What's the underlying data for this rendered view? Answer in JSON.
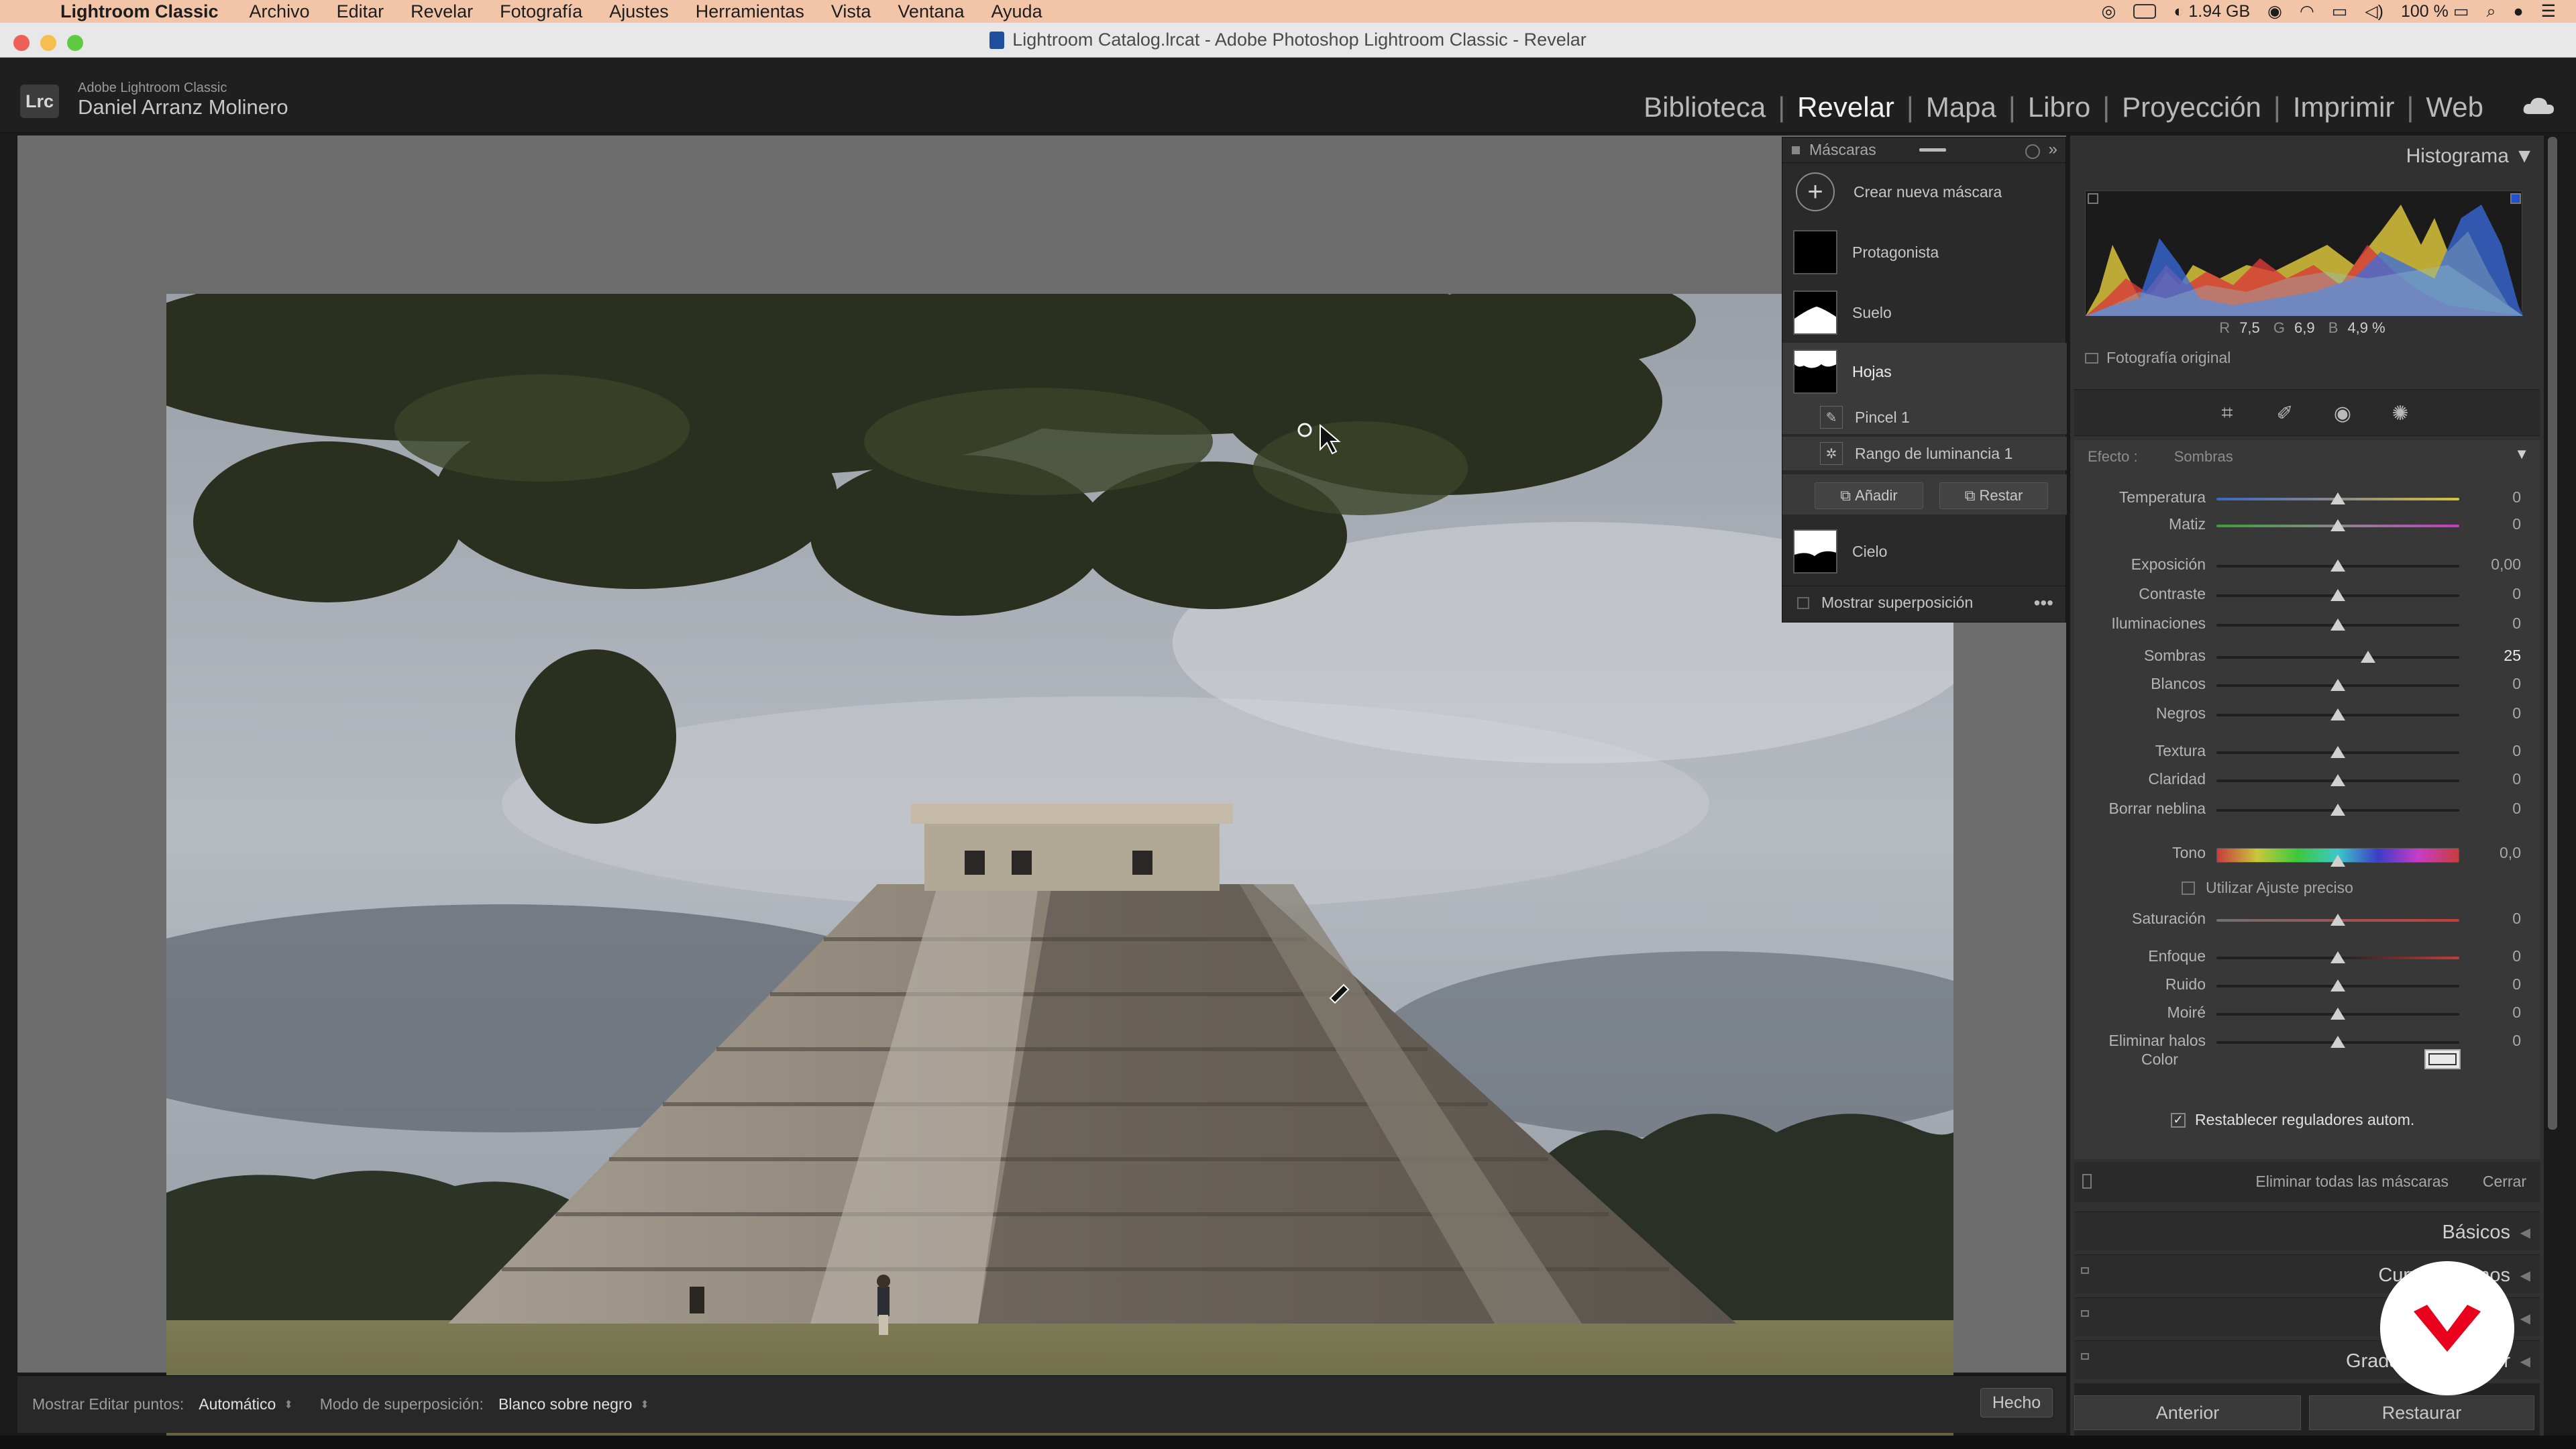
{
  "menubar": {
    "app_name": "Lightroom Classic",
    "items": [
      "Archivo",
      "Editar",
      "Revelar",
      "Fotografía",
      "Ajustes",
      "Herramientas",
      "Vista",
      "Ventana",
      "Ayuda"
    ],
    "memory": "1.94 GB",
    "battery": "100 %"
  },
  "window": {
    "title": "Lightroom Catalog.lrcat - Adobe Photoshop Lightroom Classic - Revelar"
  },
  "identity": {
    "badge": "Lrc",
    "product": "Adobe Lightroom Classic",
    "user": "Daniel Arranz Molinero"
  },
  "modules": [
    {
      "label": "Biblioteca",
      "active": false
    },
    {
      "label": "Revelar",
      "active": true
    },
    {
      "label": "Mapa",
      "active": false
    },
    {
      "label": "Libro",
      "active": false
    },
    {
      "label": "Proyección",
      "active": false
    },
    {
      "label": "Imprimir",
      "active": false
    },
    {
      "label": "Web",
      "active": false
    }
  ],
  "toolbar": {
    "show_pins_label": "Mostrar Editar puntos:",
    "show_pins_value": "Automático",
    "overlay_mode_label": "Modo de superposición:",
    "overlay_mode_value": "Blanco sobre negro",
    "done_label": "Hecho"
  },
  "masks_panel": {
    "title": "Máscaras",
    "create_label": "Crear nueva máscara",
    "masks": [
      {
        "name": "Protagonista",
        "selected": false
      },
      {
        "name": "Suelo",
        "selected": false
      },
      {
        "name": "Hojas",
        "selected": true
      },
      {
        "name": "Cielo",
        "selected": false
      }
    ],
    "components": [
      {
        "name": "Pincel 1"
      },
      {
        "name": "Rango de luminancia 1"
      }
    ],
    "add_label": "Añadir",
    "subtract_label": "Restar",
    "show_overlay_label": "Mostrar superposición"
  },
  "histogram": {
    "title": "Histograma",
    "r_label": "R",
    "r_value": "7,5",
    "g_label": "G",
    "g_value": "6,9",
    "b_label": "B",
    "b_value": "4,9 %",
    "original_label": "Fotografía original"
  },
  "adjustments": {
    "effect_label": "Efecto :",
    "effect_value": "Sombras",
    "sliders": [
      {
        "label": "Temperatura",
        "value": "0",
        "pos": 0.5,
        "gradient": "temp"
      },
      {
        "label": "Matiz",
        "value": "0",
        "pos": 0.5,
        "gradient": "tint"
      },
      {
        "label": "Exposición",
        "value": "0,00",
        "pos": 0.5
      },
      {
        "label": "Contraste",
        "value": "0",
        "pos": 0.5
      },
      {
        "label": "Iluminaciones",
        "value": "0",
        "pos": 0.5
      },
      {
        "label": "Sombras",
        "value": "25",
        "pos": 0.625,
        "highlight": true
      },
      {
        "label": "Blancos",
        "value": "0",
        "pos": 0.5
      },
      {
        "label": "Negros",
        "value": "0",
        "pos": 0.5
      },
      {
        "label": "Textura",
        "value": "0",
        "pos": 0.5
      },
      {
        "label": "Claridad",
        "value": "0",
        "pos": 0.5
      },
      {
        "label": "Borrar neblina",
        "value": "0",
        "pos": 0.5
      },
      {
        "label": "Tono",
        "value": "0,0",
        "pos": 0.5,
        "gradient": "hue"
      },
      {
        "label": "Saturación",
        "value": "0",
        "pos": 0.5,
        "gradient": "sat"
      },
      {
        "label": "Enfoque",
        "value": "0",
        "pos": 0.5,
        "gradient": "warm"
      },
      {
        "label": "Ruido",
        "value": "0",
        "pos": 0.5
      },
      {
        "label": "Moiré",
        "value": "0",
        "pos": 0.5
      },
      {
        "label": "Eliminar halos",
        "value": "0",
        "pos": 0.5
      }
    ],
    "fine_adjust_label": "Utilizar Ajuste preciso",
    "color_label": "Color",
    "reset_sliders_label": "Restablecer reguladores autom.",
    "delete_all_label": "Eliminar todas las máscaras",
    "close_label": "Cerrar"
  },
  "sections": [
    {
      "label": "Básicos"
    },
    {
      "label": "Curva de tonos"
    },
    {
      "label": ""
    },
    {
      "label": "Gradación de color"
    }
  ],
  "nav": {
    "previous_label": "Anterior",
    "reset_label": "Restaurar"
  },
  "colors": {
    "menubar": "#f2c5a8",
    "panel": "#383838",
    "accent_logo": "#e8001c"
  }
}
